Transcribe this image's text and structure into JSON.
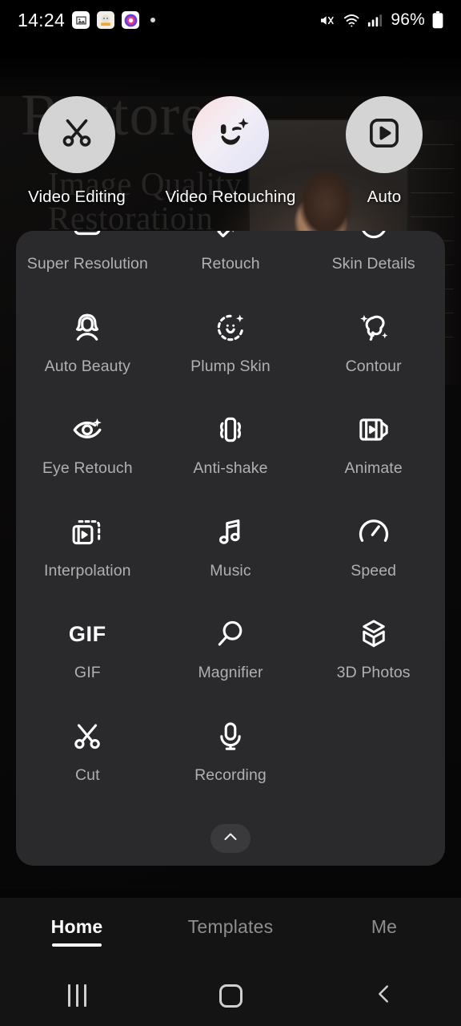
{
  "status_bar": {
    "time": "14:24",
    "battery_percent": "96%",
    "notification_icons": [
      "gallery-icon",
      "character-app-icon",
      "camera-app-icon",
      "dot-indicator"
    ],
    "system_icons": [
      "mute-icon",
      "wifi-icon",
      "signal-icon",
      "battery-icon"
    ]
  },
  "background": {
    "watermark_line1": "Image Quality",
    "watermark_line2": "Restoratioin"
  },
  "top_actions": [
    {
      "label": "Video Editing",
      "icon": "scissors-icon",
      "style": "grey"
    },
    {
      "label": "Video Retouching",
      "icon": "wink-face-icon",
      "style": "gradient"
    },
    {
      "label": "Auto",
      "icon": "play-square-icon",
      "style": "grey"
    }
  ],
  "tools": [
    {
      "label": "Super Resolution",
      "icon": "super-resolution-icon"
    },
    {
      "label": "Retouch",
      "icon": "magic-wand-sparkle-icon"
    },
    {
      "label": "Skin Details",
      "icon": "skin-details-icon"
    },
    {
      "label": "Auto Beauty",
      "icon": "auto-beauty-icon"
    },
    {
      "label": "Plump Skin",
      "icon": "plump-skin-icon"
    },
    {
      "label": "Contour",
      "icon": "contour-icon"
    },
    {
      "label": "Eye Retouch",
      "icon": "eye-retouch-icon"
    },
    {
      "label": "Anti-shake",
      "icon": "anti-shake-icon"
    },
    {
      "label": "Animate",
      "icon": "animate-icon"
    },
    {
      "label": "Interpolation",
      "icon": "interpolation-icon"
    },
    {
      "label": "Music",
      "icon": "music-note-icon"
    },
    {
      "label": "Speed",
      "icon": "speedometer-icon"
    },
    {
      "label": "GIF",
      "icon": "gif-text-icon"
    },
    {
      "label": "Magnifier",
      "icon": "magnifier-icon"
    },
    {
      "label": "3D Photos",
      "icon": "cube-3d-icon"
    },
    {
      "label": "Cut",
      "icon": "scissors-icon"
    },
    {
      "label": "Recording",
      "icon": "microphone-icon"
    }
  ],
  "panel": {
    "collapse_icon": "chevron-up-icon"
  },
  "bottom_tabs": [
    {
      "label": "Home",
      "active": true
    },
    {
      "label": "Templates",
      "active": false
    },
    {
      "label": "Me",
      "active": false
    }
  ],
  "system_nav": {
    "recents": "recents-icon",
    "home": "home-icon",
    "back": "back-icon"
  },
  "colors": {
    "panel_bg": "#2a2a2c",
    "tabbar_bg": "#141415",
    "accent_text": "#ffffff",
    "muted_text": "#b0b0b2"
  }
}
